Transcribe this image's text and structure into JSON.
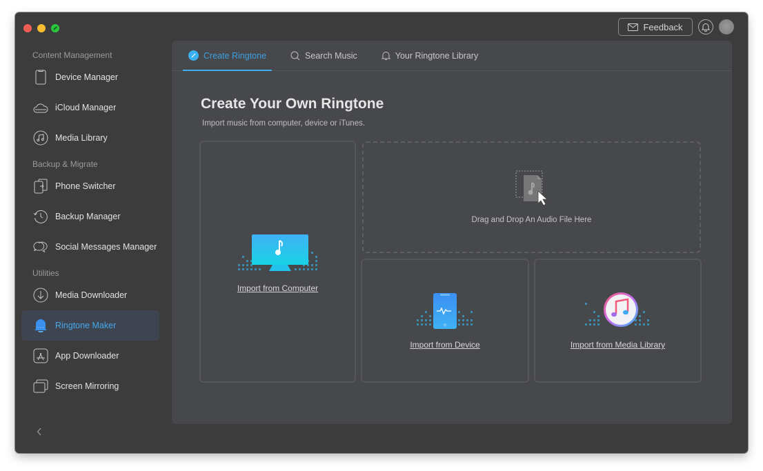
{
  "window": {
    "traffic_lights": [
      "close",
      "minimize",
      "maximize"
    ]
  },
  "topbar": {
    "feedback_label": "Feedback",
    "feedback_icon": "mail-icon",
    "notification_icon": "bell-icon",
    "avatar_icon": "user-avatar"
  },
  "sidebar": {
    "sections": [
      {
        "title": "Content Management",
        "items": [
          {
            "label": "Device Manager",
            "icon": "phone-icon"
          },
          {
            "label": "iCloud Manager",
            "icon": "cloud-icon"
          },
          {
            "label": "Media Library",
            "icon": "music-icon"
          }
        ]
      },
      {
        "title": "Backup & Migrate",
        "items": [
          {
            "label": "Phone Switcher",
            "icon": "phone-switch-icon"
          },
          {
            "label": "Backup Manager",
            "icon": "history-icon"
          },
          {
            "label": "Social Messages Manager",
            "icon": "chat-bubbles-icon"
          }
        ]
      },
      {
        "title": "Utilities",
        "items": [
          {
            "label": "Media Downloader",
            "icon": "download-icon"
          },
          {
            "label": "Ringtone Maker",
            "icon": "bell-icon",
            "active": true
          },
          {
            "label": "App Downloader",
            "icon": "app-store-icon"
          },
          {
            "label": "Screen Mirroring",
            "icon": "screens-icon"
          }
        ]
      }
    ],
    "collapse_icon": "chevron-left-icon"
  },
  "tabs": [
    {
      "label": "Create Ringtone",
      "icon": "edit-circle-icon",
      "active": true
    },
    {
      "label": "Search Music",
      "icon": "search-icon"
    },
    {
      "label": "Your Ringtone Library",
      "icon": "bell-icon"
    }
  ],
  "content": {
    "title": "Create Your Own Ringtone",
    "subtitle": "Import music from computer, device or iTunes.",
    "import_computer_label": "Import from Computer",
    "drop_label": "Drag and Drop An Audio File Here",
    "import_device_label": "Import from Device",
    "import_media_label": "Import from Media Library"
  },
  "colors": {
    "accent": "#3ab0f0",
    "active_bg": "#3e4550",
    "window_bg": "#3c3c3c",
    "panel_bg": "#47484c"
  }
}
